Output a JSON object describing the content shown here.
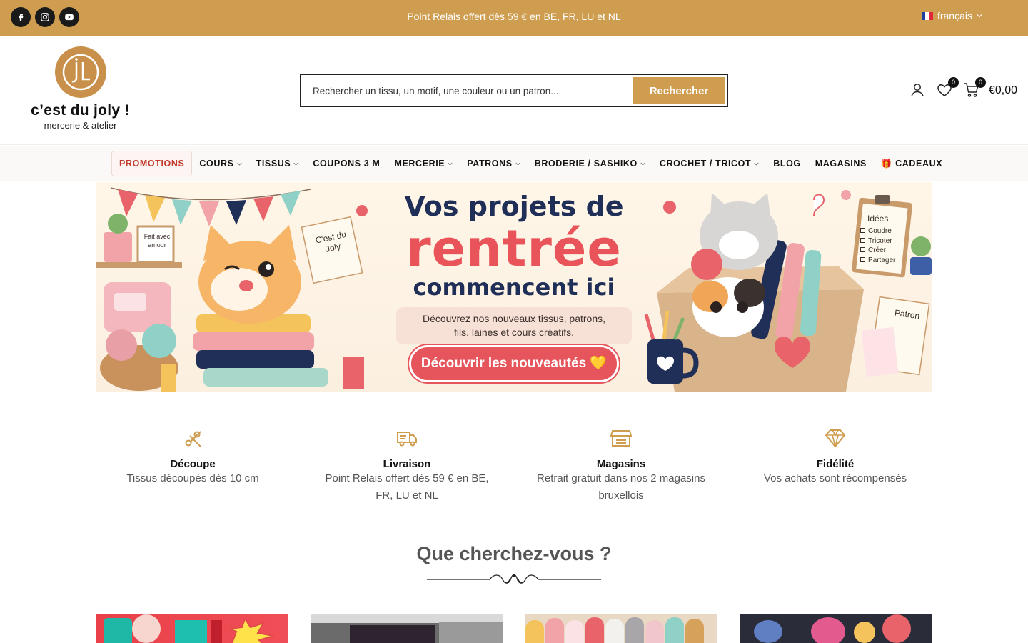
{
  "topbar": {
    "message": "Point Relais offert dès 59 € en BE, FR, LU et NL",
    "language": "français",
    "socials": [
      "facebook-icon",
      "instagram-icon",
      "youtube-icon"
    ],
    "color": "#cf9d4f"
  },
  "brand": {
    "name": "c’est du joly !",
    "subtitle": "mercerie & atelier",
    "monogram": "jL"
  },
  "search": {
    "placeholder": "Rechercher un tissu, un motif, une couleur ou un patron...",
    "button": "Rechercher"
  },
  "header_icons": {
    "wishlist_count": "0",
    "cart_count": "0",
    "cart_total": "€0,00"
  },
  "nav": [
    {
      "label": "PROMOTIONS",
      "dropdown": false
    },
    {
      "label": "COURS",
      "dropdown": true
    },
    {
      "label": "TISSUS",
      "dropdown": true
    },
    {
      "label": "COUPONS 3 M",
      "dropdown": false
    },
    {
      "label": "MERCERIE",
      "dropdown": true
    },
    {
      "label": "PATRONS",
      "dropdown": true
    },
    {
      "label": "BRODERIE / SASHIKO",
      "dropdown": true
    },
    {
      "label": "CROCHET / TRICOT",
      "dropdown": true
    },
    {
      "label": "BLOG",
      "dropdown": false
    },
    {
      "label": "MAGASINS",
      "dropdown": false
    },
    {
      "label": "🎁 CADEAUX",
      "dropdown": false
    }
  ],
  "banner": {
    "line1": "Vos projets de",
    "line2": "rentrée",
    "line3": "commencent ici",
    "subtitle_1": "Découvrez nos nouveaux tissus, patrons,",
    "subtitle_2": "fils, laines et cours créatifs.",
    "cta": "Découvrir les nouveautés 💛",
    "note_left": "Fait avec amour",
    "note_card": "C'est du Joly",
    "clipboard_title": "Idées",
    "clipboard_items": [
      "Coudre",
      "Tricoter",
      "Créer",
      "Partager"
    ],
    "pattern_label": "Patron"
  },
  "features": [
    {
      "icon": "scissors-icon",
      "title": "Découpe",
      "desc": "Tissus découpés dès 10 cm"
    },
    {
      "icon": "truck-icon",
      "title": "Livraison",
      "desc": "Point Relais offert dès 59 € en BE, FR, LU et NL"
    },
    {
      "icon": "store-icon",
      "title": "Magasins",
      "desc": "Retrait gratuit dans nos 2 magasins bruxellois"
    },
    {
      "icon": "diamond-icon",
      "title": "Fidélité",
      "desc": "Vos achats sont récompensés"
    }
  ],
  "section": {
    "title": "Que cherchez-vous ?"
  }
}
